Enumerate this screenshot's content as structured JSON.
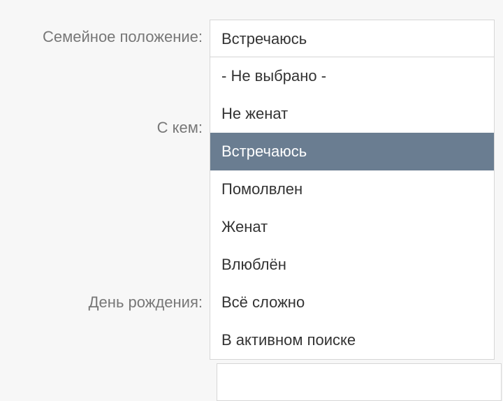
{
  "form": {
    "marital_label": "Семейное положение:",
    "with_whom_label": "С кем:",
    "birthday_label": "День рождения:",
    "marital_selected": "Встречаюсь",
    "marital_options": {
      "none": "- Не выбрано -",
      "single": "Не женат",
      "dating": "Встречаюсь",
      "engaged": "Помолвлен",
      "married": "Женат",
      "inlove": "Влюблён",
      "complicated": "Всё сложно",
      "searching": "В активном поиске"
    }
  }
}
